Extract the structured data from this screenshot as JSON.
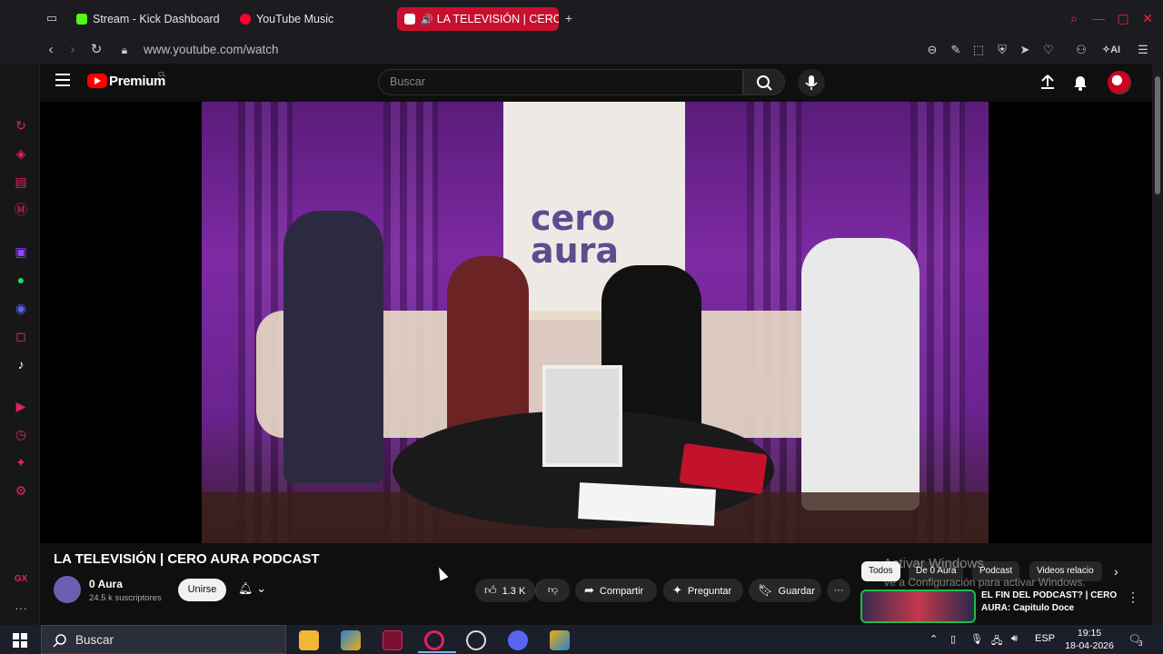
{
  "browser": {
    "tabs": [
      {
        "label": "Stream - Kick Dashboard",
        "icon": "kick-icon",
        "color": "#53fc18"
      },
      {
        "label": "YouTube Music",
        "icon": "youtube-music-icon",
        "color": "#ff0033"
      },
      {
        "label": "LA TELEVISIÓN | CERO",
        "icon": "youtube-icon",
        "color": "#ff0000",
        "active": true
      }
    ],
    "new_tab": "+",
    "url": "www.youtube.com/watch",
    "ai_label": "AI",
    "accent": "#c8102e"
  },
  "youtube": {
    "logo_text": "Premium",
    "country_code": "CL",
    "search_placeholder": "Buscar",
    "banner_text": "cero aura"
  },
  "video": {
    "title": "LA TELEVISIÓN | CERO AURA PODCAST",
    "channel": "0 Aura",
    "subscribers": "24.5 k suscriptores",
    "join": "Unirse",
    "likes": "1.3 K",
    "share": "Compartir",
    "ask": "Preguntar",
    "save": "Guardar"
  },
  "right": {
    "chips": [
      "Todos",
      "De 0 Aura",
      "Podcast",
      "Videos relacio"
    ],
    "watermark_1": "Activar Windows",
    "watermark_2": "Ve a Configuración para activar Windows.",
    "reco_title": "EL FIN DEL PODCAST? | CERO AURA: Capitulo Doce"
  },
  "taskbar": {
    "search_label": "Buscar",
    "lang": "ESP",
    "time": "19:15",
    "date": "18-04-2026",
    "notifications": "3"
  }
}
